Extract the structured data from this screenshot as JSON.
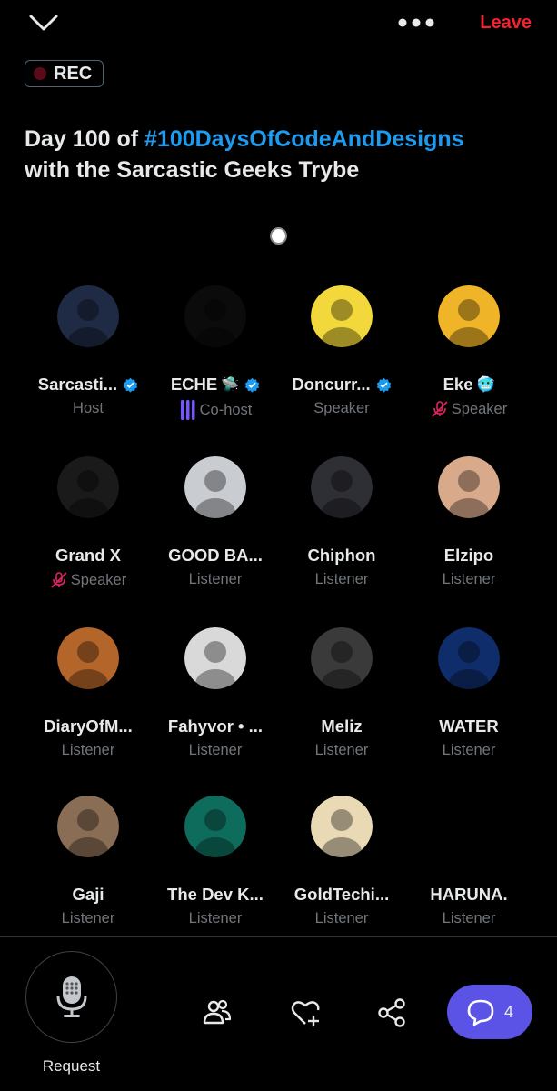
{
  "header": {
    "leave_label": "Leave",
    "rec_label": "REC",
    "title_prefix": "Day 100 of ",
    "title_hashtag": "#100DaysOfCodeAndDesigns",
    "title_suffix": "with the Sarcastic Geeks Trybe"
  },
  "participants": [
    {
      "name": "Sarcasti...",
      "role": "Host",
      "verified": true,
      "emoji": "",
      "status": "",
      "avatar_color": "#1f2a44"
    },
    {
      "name": "ECHE",
      "role": "Co-host",
      "verified": true,
      "emoji": "🛸",
      "status": "speaking",
      "avatar_color": "#0b0b0b"
    },
    {
      "name": "Doncurr...",
      "role": "Speaker",
      "verified": true,
      "emoji": "",
      "status": "",
      "avatar_color": "#f2d83a"
    },
    {
      "name": "Eke",
      "role": "Speaker",
      "verified": false,
      "emoji": "🥶",
      "status": "muted",
      "avatar_color": "#f0b429"
    },
    {
      "name": "Grand X",
      "role": "Speaker",
      "verified": false,
      "emoji": "",
      "status": "muted",
      "avatar_color": "#1a1a1a"
    },
    {
      "name": "GOOD BA...",
      "role": "Listener",
      "verified": false,
      "emoji": "",
      "status": "",
      "avatar_color": "#c9cdd1"
    },
    {
      "name": "Chiphon",
      "role": "Listener",
      "verified": false,
      "emoji": "",
      "status": "",
      "avatar_color": "#2e2e35"
    },
    {
      "name": "Elzipo",
      "role": "Listener",
      "verified": false,
      "emoji": "",
      "status": "",
      "avatar_color": "#d8a98a"
    },
    {
      "name": "DiaryOfM...",
      "role": "Listener",
      "verified": false,
      "emoji": "",
      "status": "",
      "avatar_color": "#b4652a"
    },
    {
      "name": "Fahyvor • ...",
      "role": "Listener",
      "verified": false,
      "emoji": "",
      "status": "",
      "avatar_color": "#d9d9d9"
    },
    {
      "name": "Meliz",
      "role": "Listener",
      "verified": false,
      "emoji": "",
      "status": "",
      "avatar_color": "#3a3a3a"
    },
    {
      "name": "WATER",
      "role": "Listener",
      "verified": false,
      "emoji": "",
      "status": "",
      "avatar_color": "#0f2d6b"
    },
    {
      "name": "Gaji",
      "role": "Listener",
      "verified": false,
      "emoji": "",
      "status": "",
      "avatar_color": "#8a6d55"
    },
    {
      "name": "The Dev K...",
      "role": "Listener",
      "verified": false,
      "emoji": "",
      "status": "",
      "avatar_color": "#0e6c5d"
    },
    {
      "name": "GoldTechi...",
      "role": "Listener",
      "verified": false,
      "emoji": "",
      "status": "",
      "avatar_color": "#e9d9b5"
    },
    {
      "name": "HARUNA.",
      "role": "Listener",
      "verified": false,
      "emoji": "",
      "status": "",
      "avatar_color": "#000000"
    }
  ],
  "footer": {
    "request_label": "Request",
    "chat_count": "4"
  },
  "colors": {
    "accent_blue": "#1d9bf0",
    "leave_red": "#f4212e",
    "chat_purple": "#5a53e6",
    "muted_pink": "#e0245e",
    "speaking_purple": "#7856ff"
  }
}
